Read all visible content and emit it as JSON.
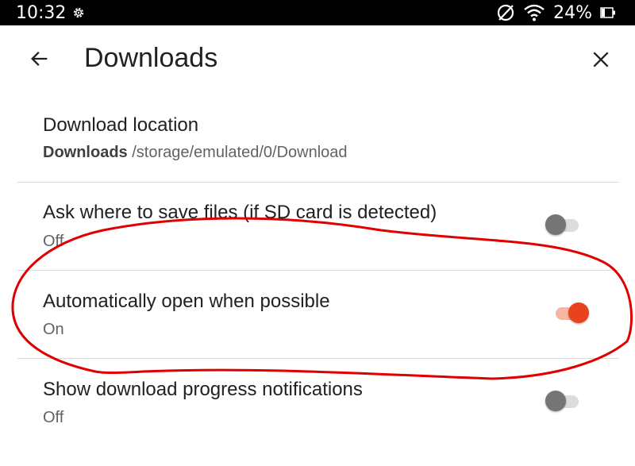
{
  "status_bar": {
    "time": "10:32",
    "battery_percent": "24%",
    "icons": [
      "gear-icon",
      "dnd-icon",
      "wifi-icon",
      "battery-icon"
    ]
  },
  "app_bar": {
    "title": "Downloads",
    "back_icon": "arrow-back-icon",
    "close_icon": "close-icon"
  },
  "settings": {
    "download_location": {
      "title": "Download location",
      "folder": "Downloads",
      "path": "/storage/emulated/0/Download"
    },
    "ask_where": {
      "title": "Ask where to save files (if SD card is detected)",
      "state": "Off",
      "enabled": false
    },
    "auto_open": {
      "title": "Automatically open when possible",
      "state": "On",
      "enabled": true
    },
    "progress_notifications": {
      "title": "Show download progress notifications",
      "state": "Off",
      "enabled": false
    }
  },
  "colors": {
    "toggle_on_thumb": "#e8431c",
    "toggle_on_track": "#f7b6a4",
    "toggle_off_thumb": "#757575",
    "toggle_off_track": "#dcdcdc",
    "annotation": "#e00000"
  }
}
